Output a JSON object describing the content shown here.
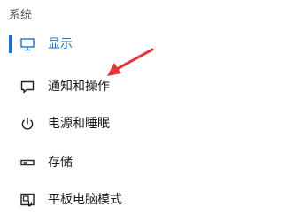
{
  "sidebar": {
    "section_title": "系统",
    "items": [
      {
        "label": "显示",
        "icon": "monitor-icon",
        "active": true
      },
      {
        "label": "通知和操作",
        "icon": "notification-icon",
        "active": false
      },
      {
        "label": "电源和睡眠",
        "icon": "power-icon",
        "active": false
      },
      {
        "label": "存储",
        "icon": "storage-icon",
        "active": false
      },
      {
        "label": "平板电脑模式",
        "icon": "tablet-mode-icon",
        "active": false
      }
    ]
  },
  "colors": {
    "accent": "#1a73c8",
    "annotation_arrow": "#e0383b"
  }
}
